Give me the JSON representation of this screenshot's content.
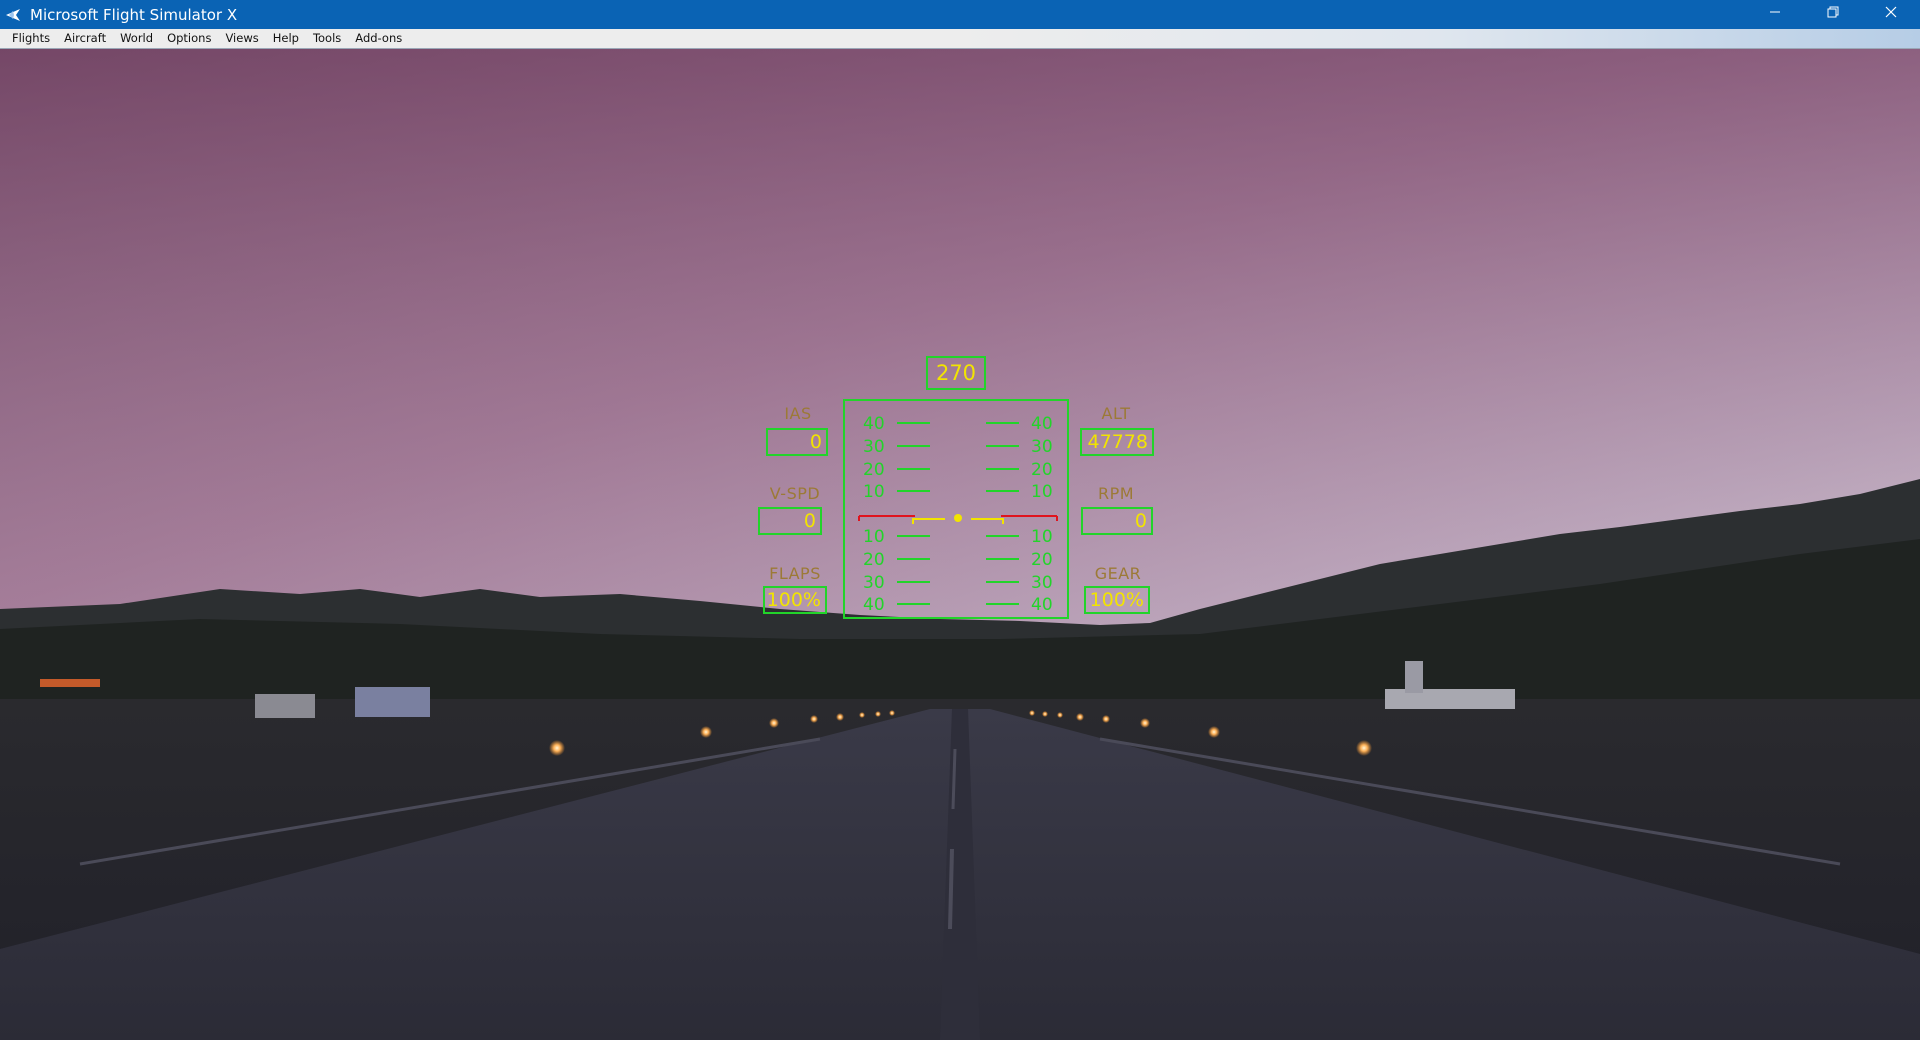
{
  "window": {
    "title": "Microsoft Flight Simulator X",
    "icon": "airplane-icon",
    "controls": [
      "minimize-icon",
      "restore-icon",
      "close-icon"
    ]
  },
  "menu": {
    "items": [
      "Flights",
      "Aircraft",
      "World",
      "Options",
      "Views",
      "Help",
      "Tools",
      "Add-ons"
    ]
  },
  "hud": {
    "heading": "270",
    "ias": {
      "label": "IAS",
      "value": "0"
    },
    "alt": {
      "label": "ALT",
      "value": "47778"
    },
    "vspd": {
      "label": "V-SPD",
      "value": "0"
    },
    "rpm": {
      "label": "RPM",
      "value": "0"
    },
    "flaps": {
      "label": "FLAPS",
      "value": "100%"
    },
    "gear": {
      "label": "GEAR",
      "value": "100%"
    },
    "pitch_ladder": {
      "up": [
        "40",
        "30",
        "20",
        "10"
      ],
      "down": [
        "10",
        "20",
        "30",
        "40"
      ]
    },
    "colors": {
      "frame": "#22d42a",
      "value": "#f2e400",
      "label": "#9c7a36",
      "horizon": "#e0141e"
    }
  }
}
